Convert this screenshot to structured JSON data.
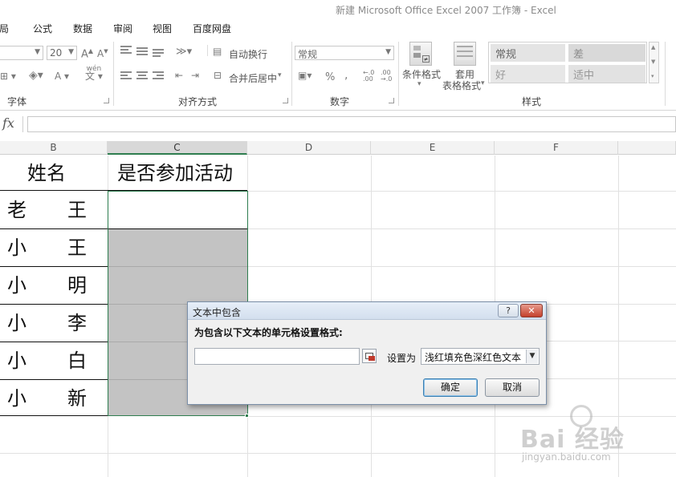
{
  "window": {
    "title": "新建 Microsoft Office Excel 2007 工作簿 - Excel"
  },
  "ribbon_tabs": [
    "局",
    "公式",
    "数据",
    "审阅",
    "视图",
    "百度网盘"
  ],
  "ribbon": {
    "font": {
      "name_value": "",
      "size_value": "20",
      "grow_icon": "A-increase-icon",
      "shrink_icon": "A-decrease-icon",
      "phonetic_label": "wén\n文",
      "group_label": "字体"
    },
    "alignment": {
      "wrap_text": "自动换行",
      "merge_center": "合并后居中",
      "group_label": "对齐方式"
    },
    "number": {
      "format_value": "常规",
      "percent": "%",
      "comma": ",",
      "inc_decimal": ".0\n.00",
      "dec_decimal": ".00\n→.0",
      "group_label": "数字"
    },
    "styles": {
      "conditional_formatting": "条件格式",
      "format_as_table_line1": "套用",
      "format_as_table_line2": "表格格式",
      "normal": "常规",
      "bad": "差",
      "good": "好",
      "neutral": "适中",
      "group_label": "样式"
    }
  },
  "formula_bar": {
    "fx_label": "fx",
    "value": ""
  },
  "sheet": {
    "columns": [
      "B",
      "C",
      "D",
      "E",
      "F"
    ],
    "header_B": "姓名",
    "header_C": "是否参加活动",
    "rows": [
      {
        "first": "老",
        "last": "王"
      },
      {
        "first": "小",
        "last": "王"
      },
      {
        "first": "小",
        "last": "明"
      },
      {
        "first": "小",
        "last": "李"
      },
      {
        "first": "小",
        "last": "白"
      },
      {
        "first": "小",
        "last": "新"
      }
    ]
  },
  "dialog": {
    "title": "文本中包含",
    "help": "?",
    "close": "✕",
    "prompt": "为包含以下文本的单元格设置格式:",
    "text_value": "",
    "set_as_label": "设置为",
    "format_value": "浅红填充色深红色文本",
    "dropdown_arrow": "▼",
    "ok": "确定",
    "cancel": "取消"
  },
  "watermark": {
    "brand": "Bai 经验",
    "url": "jingyan.baidu.com"
  }
}
